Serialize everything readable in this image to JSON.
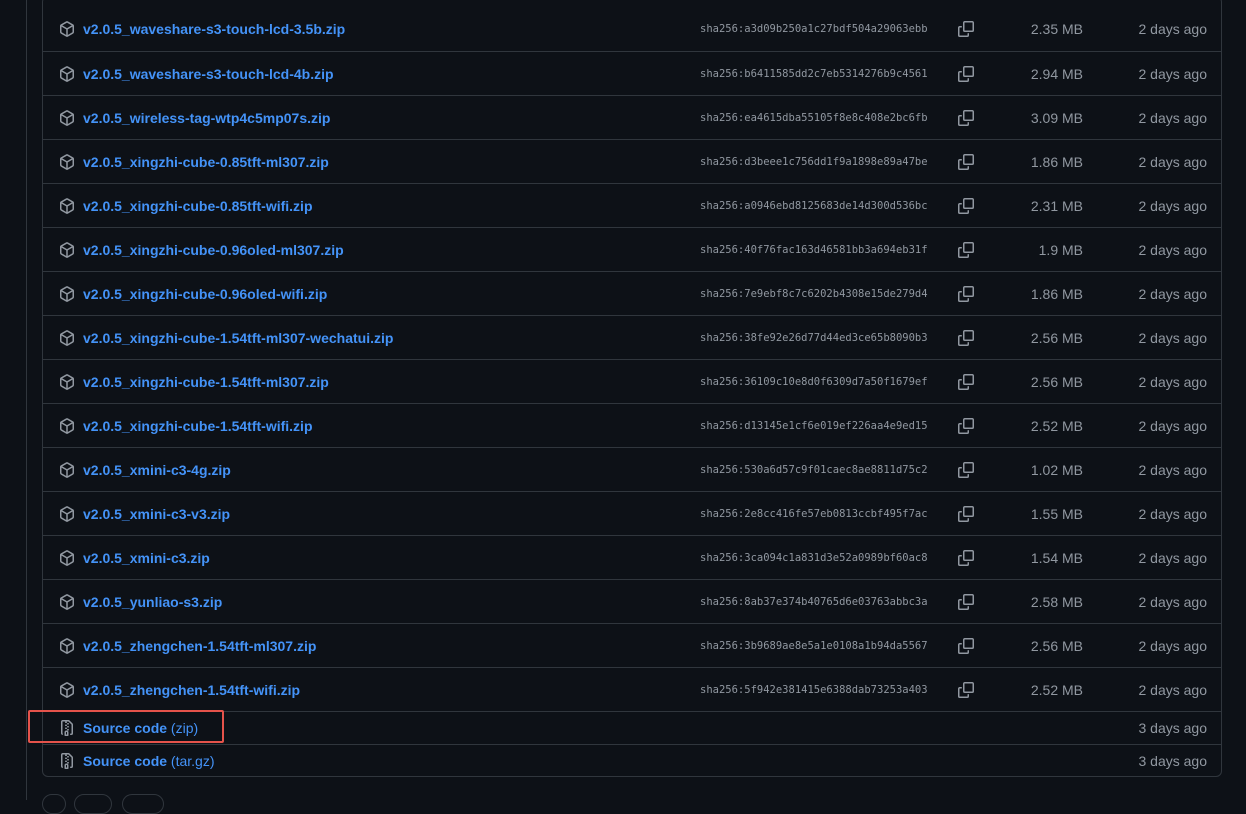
{
  "assets": [
    {
      "name": "v2.0.5_waveshare-s3-touch-lcd-3.5b.zip",
      "sha": "sha256:a3d09b250a1c27bdf504a29063ebb",
      "size": "2.35 MB",
      "date": "2 days ago"
    },
    {
      "name": "v2.0.5_waveshare-s3-touch-lcd-4b.zip",
      "sha": "sha256:b6411585dd2c7eb5314276b9c4561",
      "size": "2.94 MB",
      "date": "2 days ago"
    },
    {
      "name": "v2.0.5_wireless-tag-wtp4c5mp07s.zip",
      "sha": "sha256:ea4615dba55105f8e8c408e2bc6fb",
      "size": "3.09 MB",
      "date": "2 days ago"
    },
    {
      "name": "v2.0.5_xingzhi-cube-0.85tft-ml307.zip",
      "sha": "sha256:d3beee1c756dd1f9a1898e89a47be",
      "size": "1.86 MB",
      "date": "2 days ago"
    },
    {
      "name": "v2.0.5_xingzhi-cube-0.85tft-wifi.zip",
      "sha": "sha256:a0946ebd8125683de14d300d536bc",
      "size": "2.31 MB",
      "date": "2 days ago"
    },
    {
      "name": "v2.0.5_xingzhi-cube-0.96oled-ml307.zip",
      "sha": "sha256:40f76fac163d46581bb3a694eb31f",
      "size": "1.9 MB",
      "date": "2 days ago"
    },
    {
      "name": "v2.0.5_xingzhi-cube-0.96oled-wifi.zip",
      "sha": "sha256:7e9ebf8c7c6202b4308e15de279d4",
      "size": "1.86 MB",
      "date": "2 days ago"
    },
    {
      "name": "v2.0.5_xingzhi-cube-1.54tft-ml307-wechatui.zip",
      "sha": "sha256:38fe92e26d77d44ed3ce65b8090b3",
      "size": "2.56 MB",
      "date": "2 days ago"
    },
    {
      "name": "v2.0.5_xingzhi-cube-1.54tft-ml307.zip",
      "sha": "sha256:36109c10e8d0f6309d7a50f1679ef",
      "size": "2.56 MB",
      "date": "2 days ago"
    },
    {
      "name": "v2.0.5_xingzhi-cube-1.54tft-wifi.zip",
      "sha": "sha256:d13145e1cf6e019ef226aa4e9ed15",
      "size": "2.52 MB",
      "date": "2 days ago"
    },
    {
      "name": "v2.0.5_xmini-c3-4g.zip",
      "sha": "sha256:530a6d57c9f01caec8ae8811d75c2",
      "size": "1.02 MB",
      "date": "2 days ago"
    },
    {
      "name": "v2.0.5_xmini-c3-v3.zip",
      "sha": "sha256:2e8cc416fe57eb0813ccbf495f7ac",
      "size": "1.55 MB",
      "date": "2 days ago"
    },
    {
      "name": "v2.0.5_xmini-c3.zip",
      "sha": "sha256:3ca094c1a831d3e52a0989bf60ac8",
      "size": "1.54 MB",
      "date": "2 days ago"
    },
    {
      "name": "v2.0.5_yunliao-s3.zip",
      "sha": "sha256:8ab37e374b40765d6e03763abbc3a",
      "size": "2.58 MB",
      "date": "2 days ago"
    },
    {
      "name": "v2.0.5_zhengchen-1.54tft-ml307.zip",
      "sha": "sha256:3b9689ae8e5a1e0108a1b94da5567",
      "size": "2.56 MB",
      "date": "2 days ago"
    },
    {
      "name": "v2.0.5_zhengchen-1.54tft-wifi.zip",
      "sha": "sha256:5f942e381415e6388dab73253a403",
      "size": "2.52 MB",
      "date": "2 days ago"
    }
  ],
  "source_code": [
    {
      "label": "Source code",
      "format": "(zip)",
      "date": "3 days ago"
    },
    {
      "label": "Source code",
      "format": "(tar.gz)",
      "date": "3 days ago"
    }
  ],
  "colors": {
    "link": "#4493f8",
    "muted": "#9198a1",
    "border": "#30363d",
    "background": "#0d1117",
    "highlight": "#e5534b"
  },
  "icons": {
    "asset": "package-icon",
    "copy": "copy-icon",
    "source": "file-zip-icon"
  }
}
